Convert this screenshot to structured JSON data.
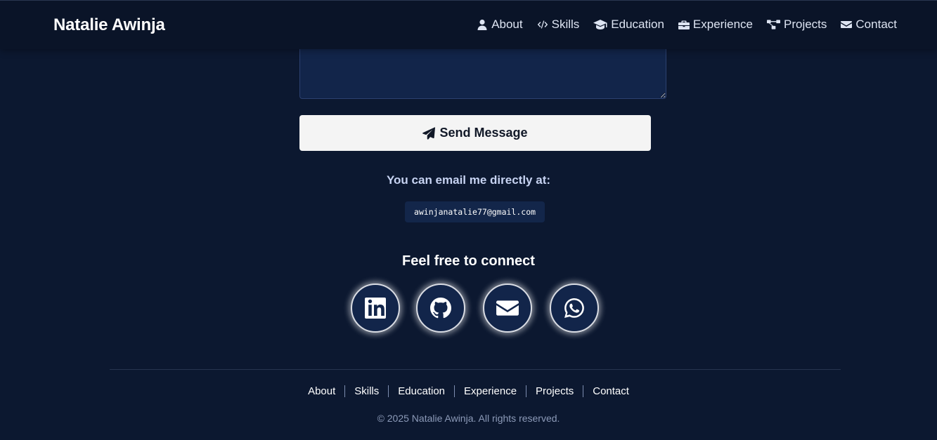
{
  "navbar": {
    "brand": "Natalie Awinja",
    "links": [
      {
        "label": "About",
        "icon": "user-icon"
      },
      {
        "label": "Skills",
        "icon": "code-icon"
      },
      {
        "label": "Education",
        "icon": "graduation-cap-icon"
      },
      {
        "label": "Experience",
        "icon": "briefcase-icon"
      },
      {
        "label": "Projects",
        "icon": "project-diagram-icon"
      },
      {
        "label": "Contact",
        "icon": "envelope-icon"
      }
    ]
  },
  "contact_form": {
    "message_value": "",
    "send_label": "Send Message",
    "send_icon": "paper-plane-icon"
  },
  "email": {
    "caption": "You can email me directly at:",
    "address": "awinjanatalie77@gmail.com"
  },
  "connect": {
    "title": "Feel free to connect",
    "socials": [
      {
        "icon": "linkedin-icon"
      },
      {
        "icon": "github-icon"
      },
      {
        "icon": "envelope-icon"
      },
      {
        "icon": "whatsapp-icon"
      }
    ]
  },
  "footer": {
    "links": [
      "About",
      "Skills",
      "Education",
      "Experience",
      "Projects",
      "Contact"
    ],
    "copyright": "© 2025 Natalie Awinja. All rights reserved."
  },
  "colors": {
    "background": "#0c1830",
    "navbar": "#0a1428",
    "input": "#12254a",
    "button": "#f4f4f4",
    "caption": "#c7d3f2"
  }
}
